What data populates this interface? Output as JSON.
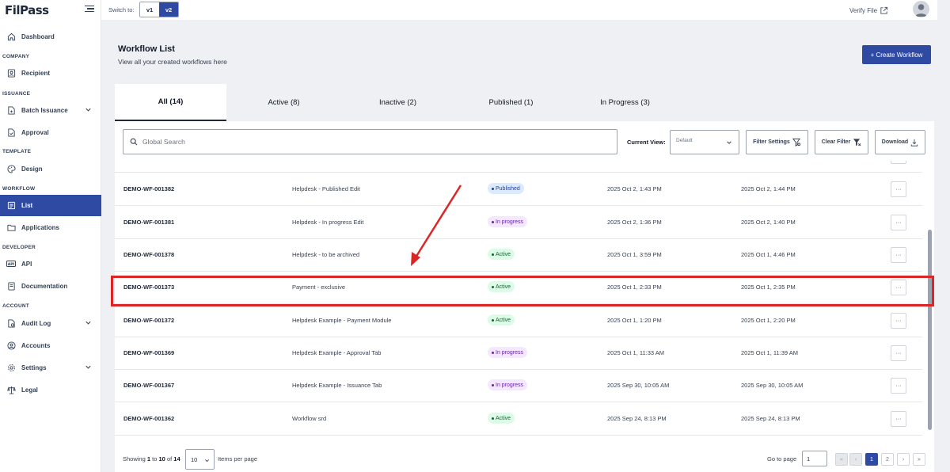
{
  "app": {
    "logo": "FilPass",
    "switch_label": "Switch to:",
    "versions": [
      "v1",
      "v2"
    ],
    "active_version": "v2",
    "verify_file": "Verify File"
  },
  "sidebar": {
    "dashboard": "Dashboard",
    "sections": {
      "company": "COMPANY",
      "issuance": "ISSUANCE",
      "template": "TEMPLATE",
      "workflow": "WORKFLOW",
      "developer": "DEVELOPER",
      "account": "ACCOUNT"
    },
    "items": {
      "recipient": "Recipient",
      "batch_issuance": "Batch Issuance",
      "approval": "Approval",
      "design": "Design",
      "list": "List",
      "applications": "Applications",
      "api": "API",
      "documentation": "Documentation",
      "audit_log": "Audit Log",
      "accounts": "Accounts",
      "settings": "Settings",
      "legal": "Legal"
    },
    "active_item": "list"
  },
  "page": {
    "title": "Workflow List",
    "subtitle": "View all your created workflows here",
    "create_button": "+ Create Workflow"
  },
  "tabs": [
    {
      "label": "All (14)",
      "active": true
    },
    {
      "label": "Active (8)",
      "active": false
    },
    {
      "label": "Inactive (2)",
      "active": false
    },
    {
      "label": "Published (1)",
      "active": false
    },
    {
      "label": "In Progress (3)",
      "active": false
    }
  ],
  "toolbar": {
    "search_placeholder": "Global Search",
    "current_view_label": "Current View:",
    "current_view_value": "Default",
    "filter_settings": "Filter Settings",
    "clear_filter": "Clear Filter",
    "download": "Download"
  },
  "rows": [
    {
      "id": "DEMO-WF-001382",
      "name": "Helpdesk - Published Edit",
      "status": "Published",
      "status_type": "published",
      "created": "2025 Oct 2, 1:43 PM",
      "updated": "2025 Oct 2, 1:44 PM",
      "action": "···"
    },
    {
      "id": "DEMO-WF-001381",
      "name": "Helpdesk - In progress Edit",
      "status": "In progress",
      "status_type": "progress",
      "created": "2025 Oct 2, 1:36 PM",
      "updated": "2025 Oct 2, 1:40 PM",
      "action": "···"
    },
    {
      "id": "DEMO-WF-001378",
      "name": "Helpdesk - to be archived",
      "status": "Active",
      "status_type": "active",
      "created": "2025 Oct 1, 3:59 PM",
      "updated": "2025 Oct 1, 4:46 PM",
      "action": "···"
    },
    {
      "id": "DEMO-WF-001373",
      "name": "Payment - exclusive",
      "status": "Active",
      "status_type": "active",
      "created": "2025 Oct 1, 2:33 PM",
      "updated": "2025 Oct 1, 2:35 PM",
      "action": "···"
    },
    {
      "id": "DEMO-WF-001372",
      "name": "Helpdesk Example - Payment Module",
      "status": "Active",
      "status_type": "active",
      "created": "2025 Oct 1, 1:20 PM",
      "updated": "2025 Oct 1, 2:20 PM",
      "action": "···"
    },
    {
      "id": "DEMO-WF-001369",
      "name": "Helpdesk Example - Approval Tab",
      "status": "In progress",
      "status_type": "progress",
      "created": "2025 Oct 1, 11:33 AM",
      "updated": "2025 Oct 1, 11:39 AM",
      "action": "···"
    },
    {
      "id": "DEMO-WF-001367",
      "name": "Helpdesk Example - Issuance Tab",
      "status": "In progress",
      "status_type": "progress",
      "created": "2025 Sep 30, 10:05 AM",
      "updated": "2025 Sep 30, 10:05 AM",
      "action": "···"
    },
    {
      "id": "DEMO-WF-001362",
      "name": "Workflow srd",
      "status": "Active",
      "status_type": "active",
      "created": "2025 Sep 24, 8:13 PM",
      "updated": "2025 Sep 24, 8:13 PM",
      "action": "···"
    }
  ],
  "footer": {
    "showing_prefix": "Showing",
    "from": "1",
    "to_word": "to",
    "to": "10",
    "of_word": "of",
    "total": "14",
    "per_page": "10",
    "items_label": "Items per page",
    "goto_label": "Go to page",
    "goto_value": "1",
    "pages": [
      "1",
      "2"
    ],
    "current_page": "1",
    "first": "«",
    "prev": "‹",
    "next": "›",
    "last": "»"
  },
  "colors": {
    "primary": "#2f4aa3",
    "annotation": "#dc2626",
    "active_badge": "#dcfce7",
    "progress_badge": "#f3e8ff",
    "published_badge": "#dbeafe"
  },
  "icons": {
    "dashboard": "home-icon",
    "recipient": "user-card-icon",
    "batch_issuance": "document-plus-icon",
    "approval": "document-check-icon",
    "design": "palette-icon",
    "list": "list-icon",
    "applications": "folder-icon",
    "api": "api-icon",
    "documentation": "book-icon",
    "audit_log": "audit-icon",
    "accounts": "user-circle-icon",
    "settings": "gear-icon",
    "legal": "scale-icon"
  }
}
